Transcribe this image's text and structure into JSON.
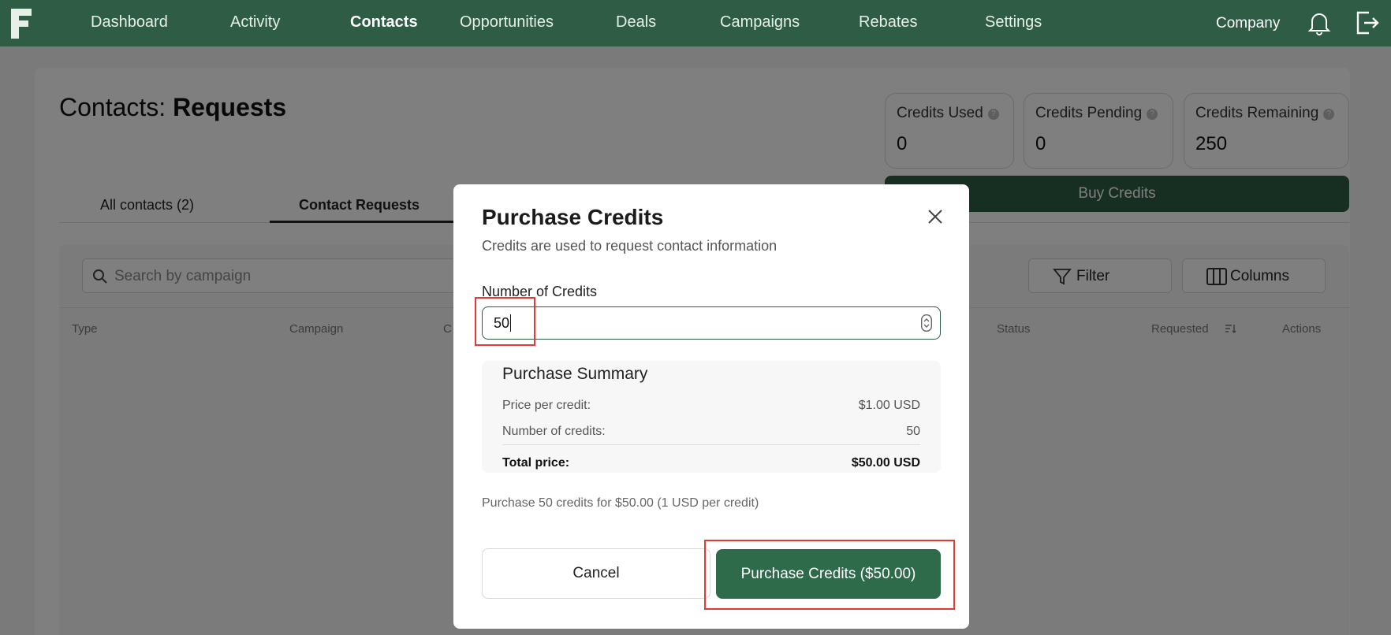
{
  "nav": {
    "items": [
      "Dashboard",
      "Activity",
      "Contacts",
      "Opportunities",
      "Deals",
      "Campaigns",
      "Rebates",
      "Settings"
    ],
    "active": "Contacts",
    "company": "Company"
  },
  "page": {
    "title_prefix": "Contacts: ",
    "title_main": "Requests"
  },
  "stats": [
    {
      "label": "Credits Used",
      "value": "0"
    },
    {
      "label": "Credits Pending",
      "value": "0"
    },
    {
      "label": "Credits Remaining",
      "value": "250"
    }
  ],
  "buy_button": "Buy Credits",
  "tabs": [
    {
      "label": "All contacts (2)"
    },
    {
      "label": "Contact Requests"
    }
  ],
  "search": {
    "placeholder": "Search by campaign"
  },
  "toolbar": {
    "filter": "Filter",
    "columns": "Columns"
  },
  "table_headers": [
    "Type",
    "Campaign",
    "C",
    "Status",
    "Requested",
    "Actions"
  ],
  "modal": {
    "title": "Purchase Credits",
    "subtitle": "Credits are used to request contact information",
    "field_label": "Number of Credits",
    "field_value": "50",
    "summary": {
      "title": "Purchase Summary",
      "price_label": "Price per credit:",
      "price_value": "$1.00 USD",
      "count_label": "Number of credits:",
      "count_value": "50",
      "total_label": "Total price:",
      "total_value": "$50.00 USD"
    },
    "note": "Purchase 50 credits for $50.00 (1 USD per credit)",
    "cancel": "Cancel",
    "purchase": "Purchase Credits ($50.00)"
  },
  "colors": {
    "brand": "#2e5c45",
    "highlight": "#e53935"
  }
}
